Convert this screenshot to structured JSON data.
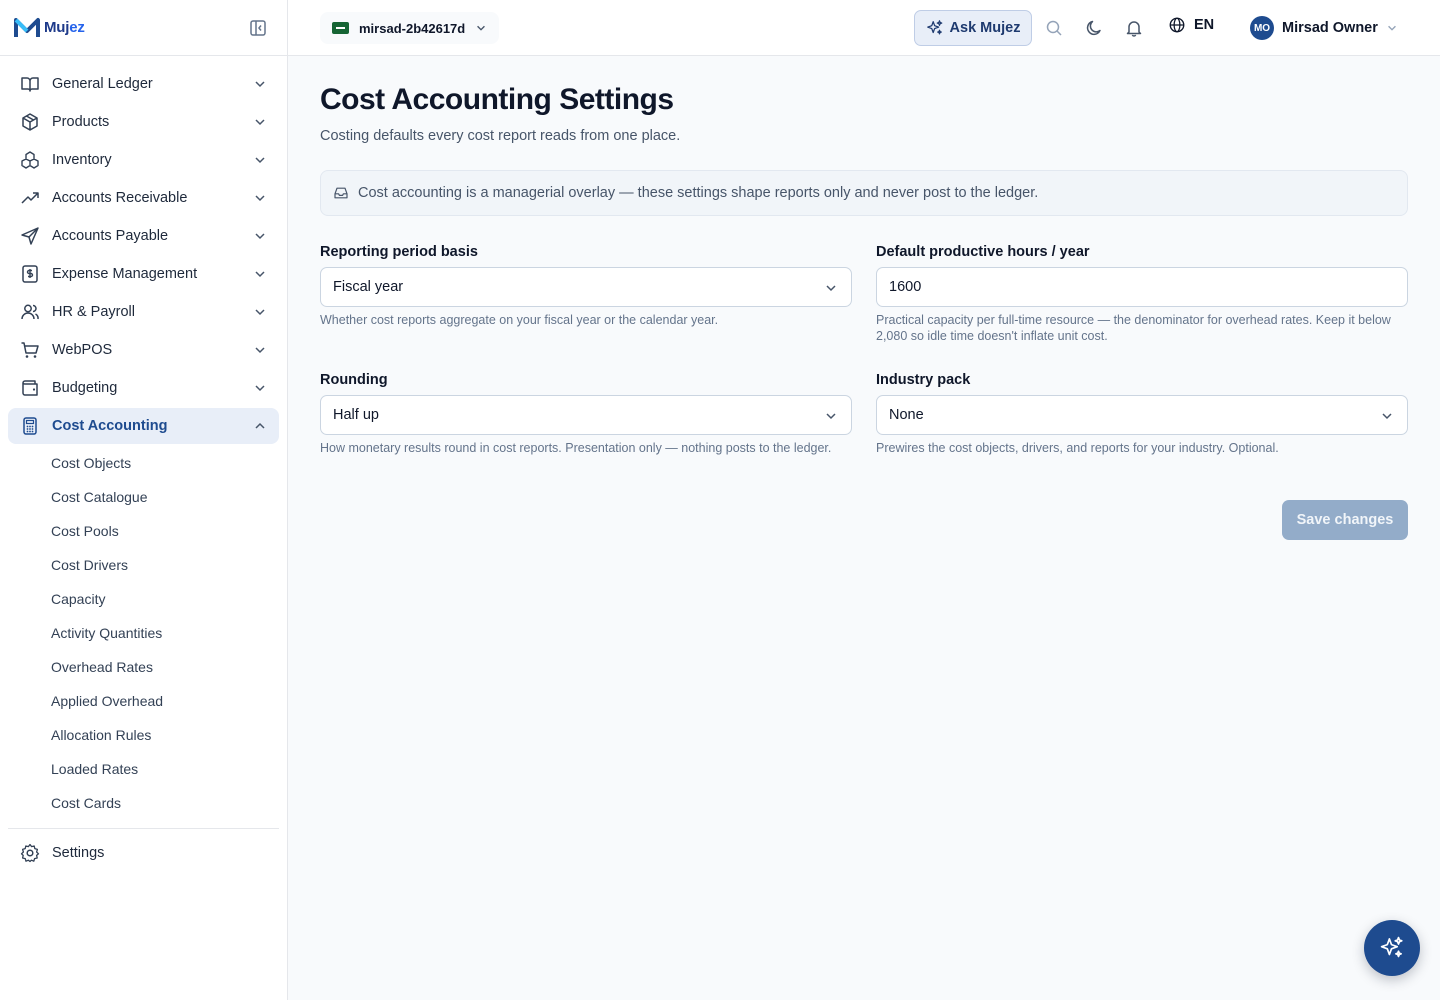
{
  "brand": {
    "name_part1": "Muj",
    "name_part2": "ez"
  },
  "sidebar": {
    "items": [
      {
        "label": "General Ledger",
        "icon": "book-open-icon"
      },
      {
        "label": "Products",
        "icon": "box-icon"
      },
      {
        "label": "Inventory",
        "icon": "boxes-icon"
      },
      {
        "label": "Accounts Receivable",
        "icon": "trending-up-icon"
      },
      {
        "label": "Accounts Payable",
        "icon": "send-icon"
      },
      {
        "label": "Expense Management",
        "icon": "receipt-icon"
      },
      {
        "label": "HR & Payroll",
        "icon": "users-icon"
      },
      {
        "label": "WebPOS",
        "icon": "cart-icon"
      },
      {
        "label": "Budgeting",
        "icon": "wallet-icon"
      },
      {
        "label": "Cost Accounting",
        "icon": "calculator-icon"
      }
    ],
    "sub_items": [
      "Cost Objects",
      "Cost Catalogue",
      "Cost Pools",
      "Cost Drivers",
      "Capacity",
      "Activity Quantities",
      "Overhead Rates",
      "Applied Overhead",
      "Allocation Rules",
      "Loaded Rates",
      "Cost Cards"
    ],
    "settings_label": "Settings"
  },
  "topbar": {
    "company": "mirsad-2b42617d",
    "ask_label": "Ask Mujez",
    "language": "EN",
    "user_initials": "MO",
    "user_name": "Mirsad Owner"
  },
  "page": {
    "title": "Cost Accounting Settings",
    "subtitle": "Costing defaults every cost report reads from one place.",
    "notice": "Cost accounting is a managerial overlay — these settings shape reports only and never post to the ledger.",
    "fields": {
      "period": {
        "label": "Reporting period basis",
        "value": "Fiscal year",
        "help": "Whether cost reports aggregate on your fiscal year or the calendar year."
      },
      "hours": {
        "label": "Default productive hours / year",
        "value": "1600",
        "help": "Practical capacity per full-time resource — the denominator for overhead rates. Keep it below 2,080 so idle time doesn't inflate unit cost."
      },
      "rounding": {
        "label": "Rounding",
        "value": "Half up",
        "help": "How monetary results round in cost reports. Presentation only — nothing posts to the ledger."
      },
      "industry": {
        "label": "Industry pack",
        "value": "None",
        "help": "Prewires the cost objects, drivers, and reports for your industry. Optional."
      }
    },
    "save_label": "Save changes"
  },
  "colors": {
    "primary": "#1e4b8f",
    "active_bg": "#e8eef8",
    "save_disabled": "#93acc9"
  }
}
